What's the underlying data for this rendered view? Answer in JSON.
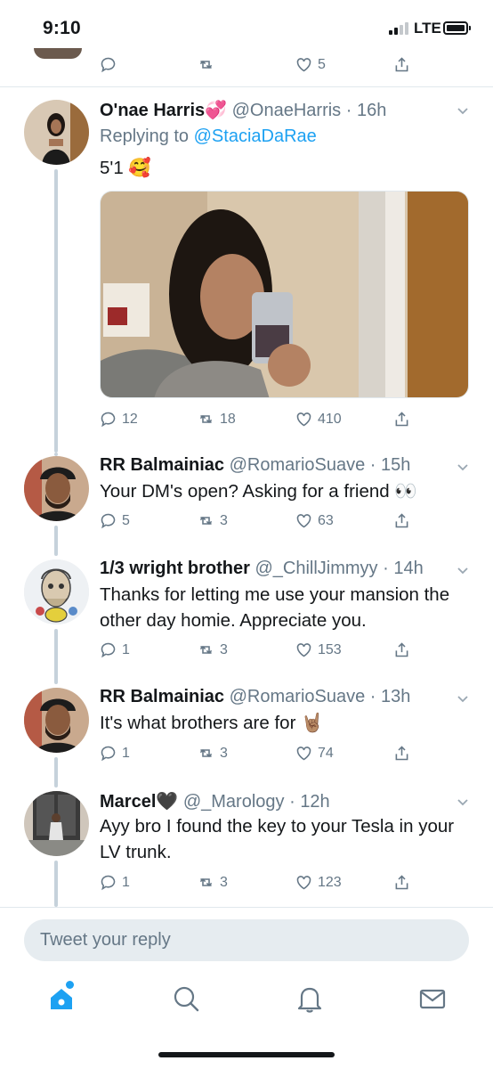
{
  "status_bar": {
    "time": "9:10",
    "network": "LTE"
  },
  "top_tweet": {
    "likes": "5"
  },
  "tweets": [
    {
      "name": "O'nae Harris",
      "name_emoji": "💞",
      "handle": "@OnaeHarris",
      "time": "16h",
      "reply_prefix": "Replying to",
      "reply_to": "@StaciaDaRae",
      "text": "5'1 🥰",
      "has_media": true,
      "replies": "12",
      "retweets": "18",
      "likes": "410"
    },
    {
      "name": "RR Balmainiac",
      "handle": "@RomarioSuave",
      "time": "15h",
      "text": "Your DM's open? Asking for a friend 👀",
      "replies": "5",
      "retweets": "3",
      "likes": "63"
    },
    {
      "name": "1/3 wright brother",
      "handle": "@_ChillJimmyy",
      "time": "14h",
      "text": "Thanks for letting me use your mansion the other day homie. Appreciate you.",
      "replies": "1",
      "retweets": "3",
      "likes": "153"
    },
    {
      "name": "RR Balmainiac",
      "handle": "@RomarioSuave",
      "time": "13h",
      "text": "It's what brothers are for 🤘🏽",
      "replies": "1",
      "retweets": "3",
      "likes": "74"
    },
    {
      "name": "Marcel🖤",
      "handle": "@_Marology",
      "time": "12h",
      "text": "Ayy bro I found the key to your Tesla in your LV trunk.",
      "replies": "1",
      "retweets": "3",
      "likes": "123"
    }
  ],
  "reply_box": {
    "placeholder": "Tweet your reply"
  },
  "tabs": [
    "home-icon",
    "search-icon",
    "notifications-icon",
    "messages-icon"
  ],
  "colors": {
    "accent": "#1da1f2",
    "muted": "#657786",
    "thread": "#c6d2db"
  }
}
